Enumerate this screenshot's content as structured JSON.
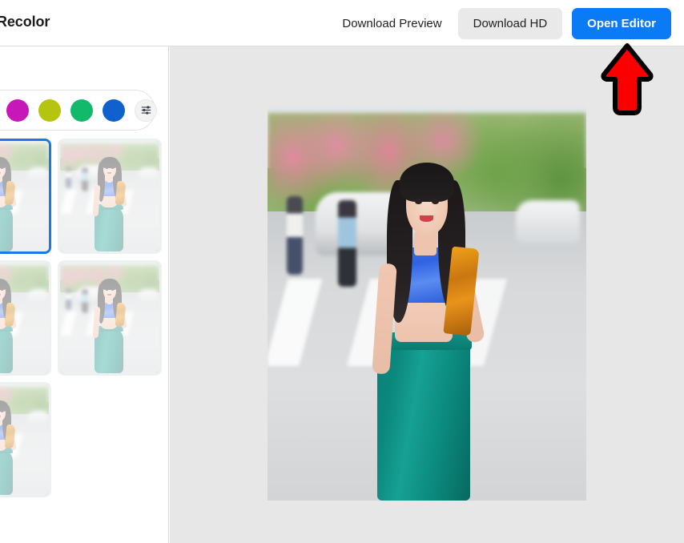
{
  "header": {
    "title": "Recolor",
    "download_preview_label": "Download Preview",
    "download_hd_label": "Download HD",
    "open_editor_label": "Open Editor",
    "primary_color": "#0b7bf5",
    "secondary_bg": "#e9e9e9"
  },
  "sidebar": {
    "swatches": [
      {
        "name": "swatch-orange",
        "color": "#d4820f"
      },
      {
        "name": "swatch-magenta",
        "color": "#c817b9"
      },
      {
        "name": "swatch-yellow-green",
        "color": "#b5c40e"
      },
      {
        "name": "swatch-green",
        "color": "#13b96b"
      },
      {
        "name": "swatch-blue",
        "color": "#1060ce"
      }
    ],
    "more_options_icon": "sliders-icon",
    "thumbnails": [
      {
        "name": "variant-1",
        "selected": true
      },
      {
        "name": "variant-2",
        "selected": false
      },
      {
        "name": "variant-3",
        "selected": false
      },
      {
        "name": "variant-4",
        "selected": false
      },
      {
        "name": "variant-5",
        "selected": false
      }
    ],
    "selected_border_color": "#1878ec"
  },
  "canvas": {
    "background": "#e7e7e7",
    "preview_alt": "recolored-photo-preview"
  },
  "annotation": {
    "type": "arrow-up",
    "fill": "#fb0000",
    "stroke": "#000000",
    "points_at": "Open Editor"
  }
}
